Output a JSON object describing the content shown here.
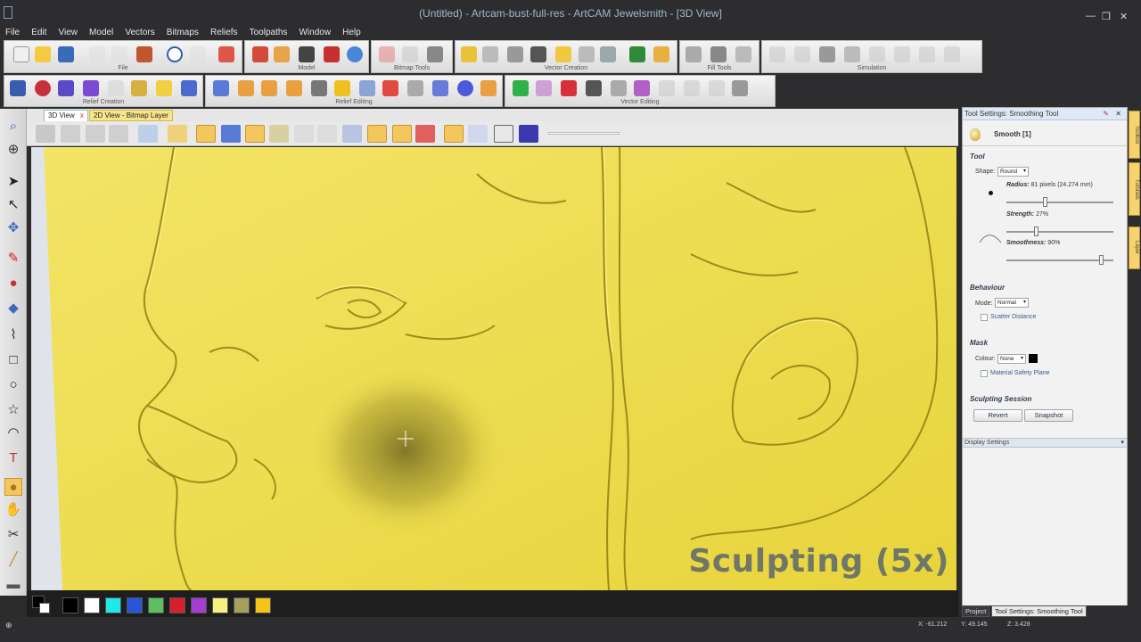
{
  "window": {
    "title": "(Untitled) - Artcam-bust-full-res - ArtCAM Jewelsmith - [3D View]",
    "controls": [
      "—",
      "❐",
      "✕"
    ]
  },
  "menu": [
    "File",
    "Edit",
    "View",
    "Model",
    "Vectors",
    "Bitmaps",
    "Reliefs",
    "Toolpaths",
    "Window",
    "Help"
  ],
  "toolbar_groups": {
    "file": "File",
    "model": "Model",
    "bitmap_tools": "Bitmap Tools",
    "vector_creation": "Vector Creation",
    "fill_tools": "Fill Tools",
    "simulation": "Simulation",
    "relief_creation": "Relief Creation",
    "relief_editing": "Relief Editing",
    "vector_editing": "Vector Editing"
  },
  "view_tabs": [
    {
      "label": "3D View",
      "active": true,
      "close": "x"
    },
    {
      "label": "2D View - Bitmap Layer",
      "active": false
    }
  ],
  "viewport": {
    "caption": "Sculpting (5x)",
    "cursor": "crosshair-icon"
  },
  "palette": {
    "colors": [
      "#000000",
      "#ffffff",
      "#1fe8e8",
      "#2a55d8",
      "#5fbe5f",
      "#d8202c",
      "#a43ed0",
      "#f6f080",
      "#a6a060",
      "#f4c418"
    ]
  },
  "panel": {
    "title": "Tool Settings: Smoothing Tool",
    "tool_name": "Smooth [1]",
    "tool_section": "Tool",
    "shape_label": "Shape:",
    "shape_value": "Round",
    "radius_label": "Radius:",
    "radius_value": "81 pixels (24.274 mm)",
    "radius_fraction": 0.36,
    "strength_label": "Strength:",
    "strength_value": "27%",
    "strength_fraction": 0.27,
    "smoothness_label": "Smoothness:",
    "smoothness_value": "90%",
    "smoothness_fraction": 0.9,
    "behaviour_section": "Behaviour",
    "mode_label": "Mode:",
    "mode_value": "Normal",
    "scatter_label": "Scatter Distance",
    "mask_section": "Mask",
    "colour_label": "Colour:",
    "colour_value": "None",
    "material_label": "Material Safety Plane",
    "session_section": "Sculpting Session",
    "revert_label": "Revert",
    "snapshot_label": "Snapshot",
    "display_settings": "Display Settings"
  },
  "side_tabs": [
    "Toolbox",
    "Tutorials",
    "Layer"
  ],
  "bottom_tabs": [
    {
      "label": "Project",
      "active": false
    },
    {
      "label": "Tool Settings: Smoothing Tool",
      "active": true
    }
  ],
  "status": {
    "x": "X: -61.212",
    "y": "Y: 49.145",
    "z": "Z: 3.428"
  }
}
